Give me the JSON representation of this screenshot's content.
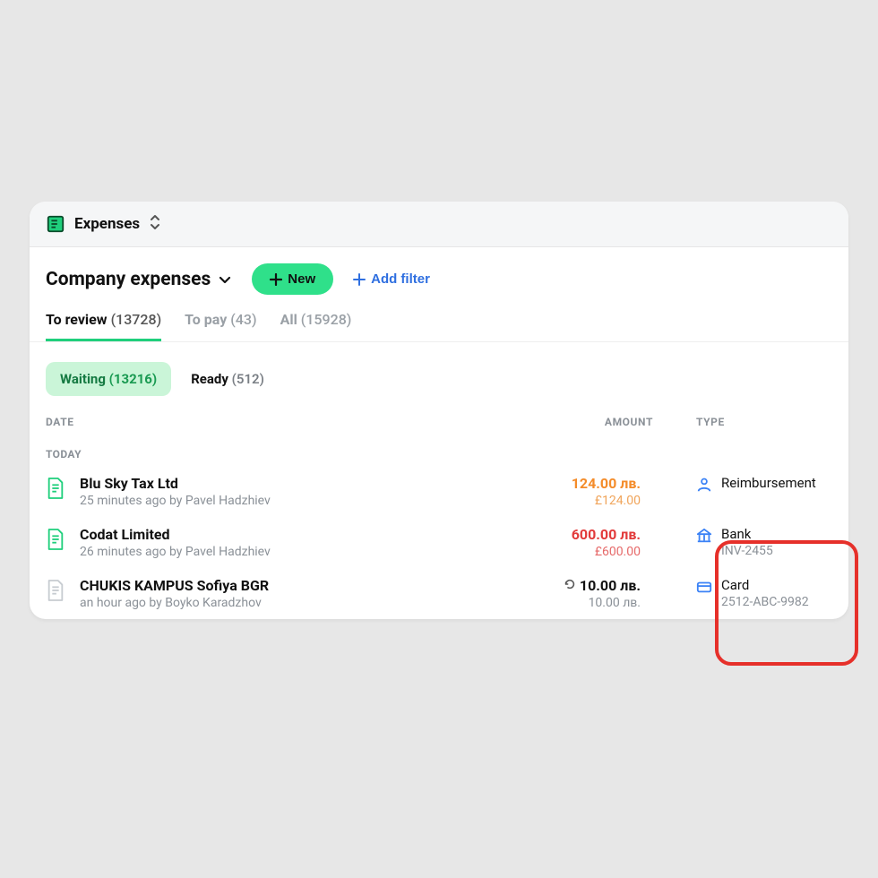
{
  "header": {
    "title": "Expenses"
  },
  "page": {
    "title": "Company expenses",
    "new_button": "New",
    "add_filter": "Add filter"
  },
  "tabs": [
    {
      "label": "To review",
      "count": "(13728)",
      "active": true
    },
    {
      "label": "To pay",
      "count": "(43)",
      "active": false
    },
    {
      "label": "All",
      "count": "(15928)",
      "active": false
    }
  ],
  "subfilters": {
    "waiting": {
      "label": "Waiting",
      "count": "(13216)"
    },
    "ready": {
      "label": "Ready",
      "count": "(512)"
    }
  },
  "columns": {
    "date": "DATE",
    "amount": "AMOUNT",
    "type": "TYPE"
  },
  "section_label": "TODAY",
  "rows": [
    {
      "title": "Blu Sky Tax Ltd",
      "sub": "25 minutes ago by Pavel Hadzhiev",
      "amount": "124.00 лв.",
      "amount_sub": "£124.00",
      "amount_style": "orange",
      "doc_style": "green",
      "recur": false,
      "type_icon": "person",
      "type_label": "Reimbursement",
      "type_sub": ""
    },
    {
      "title": "Codat Limited",
      "sub": "26 minutes ago by Pavel Hadzhiev",
      "amount": "600.00 лв.",
      "amount_sub": "£600.00",
      "amount_style": "red",
      "doc_style": "green",
      "recur": false,
      "type_icon": "bank",
      "type_label": "Bank",
      "type_sub": "INV-2455"
    },
    {
      "title": "CHUKIS KAMPUS Sofiya BGR",
      "sub": "an hour ago by Boyko Karadzhov",
      "amount": "10.00 лв.",
      "amount_sub": "10.00 лв.",
      "amount_style": "black",
      "doc_style": "grey",
      "recur": true,
      "type_icon": "card",
      "type_label": "Card",
      "type_sub": "2512-ABC-9982"
    }
  ]
}
